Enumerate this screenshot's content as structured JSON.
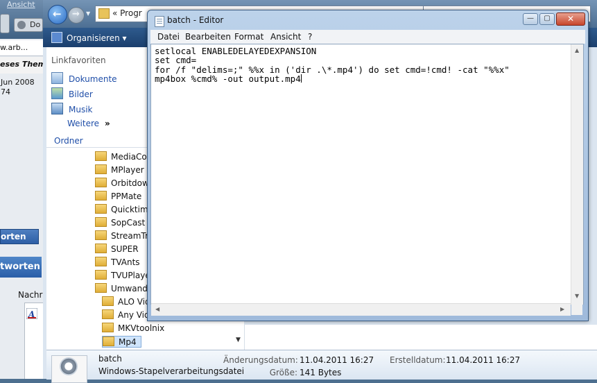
{
  "browser": {
    "menu_label": "Ansicht",
    "toolbar_label": "Do",
    "address_fragment": "w.arb...",
    "thread_fragment": "eses Thema",
    "date_fragment": "Jun 2008",
    "number_fragment": "74",
    "reply_button_small": "orten",
    "reply_button_large": "tworten",
    "message_label": "Nachr"
  },
  "explorer": {
    "breadcrumb": "«  Progr",
    "organize_label": "Organisieren",
    "favorites_title": "Linkfavoriten",
    "favorites": [
      {
        "label": "Dokumente",
        "icon": "documents-icon"
      },
      {
        "label": "Bilder",
        "icon": "pictures-icon"
      },
      {
        "label": "Musik",
        "icon": "music-icon"
      }
    ],
    "more_label": "Weitere",
    "more_glyph": "»",
    "folders_label": "Ordner",
    "tree": [
      {
        "label": "MediaCoc",
        "level": 1
      },
      {
        "label": "MPlayer",
        "level": 1
      },
      {
        "label": "Orbitdown",
        "level": 1
      },
      {
        "label": "PPMate",
        "level": 1
      },
      {
        "label": "Quicktime",
        "level": 1
      },
      {
        "label": "SopCast",
        "level": 1
      },
      {
        "label": "StreamTra",
        "level": 1
      },
      {
        "label": "SUPER",
        "level": 1
      },
      {
        "label": "TVAnts",
        "level": 1
      },
      {
        "label": "TVUPlayer",
        "level": 1
      },
      {
        "label": "Umwande",
        "level": 1
      },
      {
        "label": "ALO Vid",
        "level": 2
      },
      {
        "label": "Any Vid",
        "level": 2
      },
      {
        "label": "MKVtoolnix",
        "level": 2
      },
      {
        "label": "Mp4",
        "level": 2,
        "selected": true
      }
    ],
    "details": {
      "file_name": "batch",
      "file_type": "Windows-Stapelverarbeitungsdatei",
      "modified_label": "Änderungsdatum:",
      "modified_value": "11.04.2011 16:27",
      "size_label": "Größe:",
      "size_value": "141 Bytes",
      "created_label": "Erstelldatum:",
      "created_value": "11.04.2011 16:27"
    }
  },
  "notepad": {
    "title": "batch - Editor",
    "menu": [
      "Datei",
      "Bearbeiten",
      "Format",
      "Ansicht",
      "?"
    ],
    "lines": [
      "setlocal ENABLEDELAYEDEXPANSION",
      "set cmd=",
      "for /f \"delims=;\" %%x in ('dir .\\*.mp4') do set cmd=!cmd! -cat \"%%x\"",
      "mp4box %cmd% -out output.mp4"
    ],
    "minimize_glyph": "—",
    "maximize_glyph": "▢",
    "close_glyph": "✕"
  }
}
